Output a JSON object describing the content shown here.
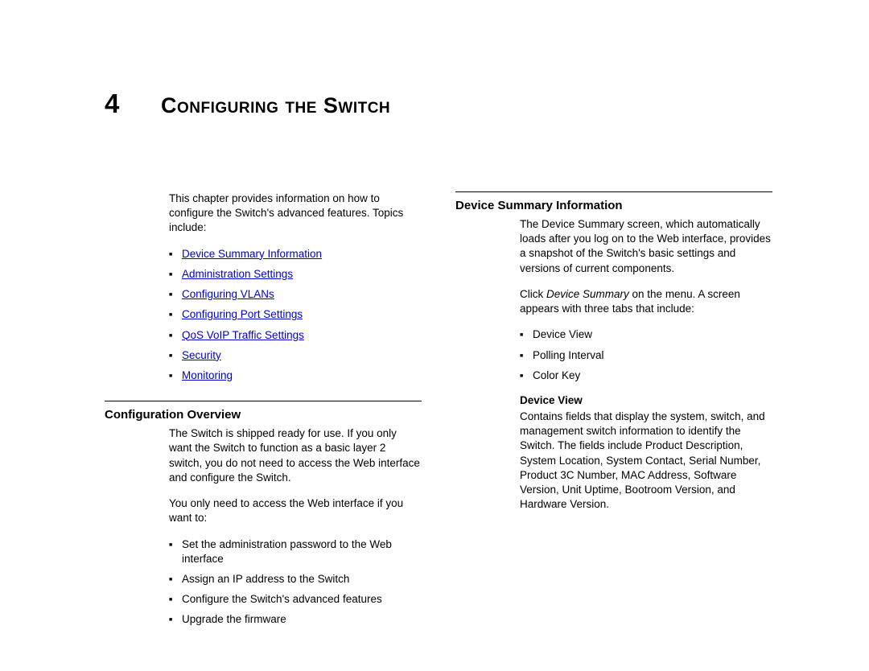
{
  "chapter": {
    "number": "4",
    "title": "Configuring the Switch"
  },
  "left": {
    "intro": "This chapter provides information on how to configure the Switch's advanced features. Topics include:",
    "links": [
      "Device Summary Information",
      "Administration Settings",
      "Configuring VLANs",
      "Configuring Port Settings",
      "QoS VoIP Traffic Settings",
      "Security",
      "Monitoring"
    ],
    "overview_heading": "Configuration Overview",
    "overview_p1": "The Switch is shipped ready for use. If you only want the Switch to function as a basic layer 2 switch, you do not need to access the Web interface and configure the Switch.",
    "overview_p2": "You only need to access the Web interface if you want to:",
    "overview_list": [
      "Set the administration password to the Web interface",
      "Assign an IP address to the Switch",
      "Configure the Switch's advanced features",
      "Upgrade the firmware"
    ]
  },
  "right": {
    "heading": "Device Summary Information",
    "p1": "The Device Summary screen, which automatically loads after you log on to the Web interface, provides a snapshot of the Switch's basic settings and versions of current components.",
    "p2_pre": "Click ",
    "p2_italic": "Device Summary",
    "p2_post": " on the menu. A screen appears with three tabs that include:",
    "tabs": [
      "Device View",
      "Polling Interval",
      "Color Key"
    ],
    "dv_heading": "Device View",
    "dv_body": "Contains fields that display the system, switch, and management switch information to identify the Switch. The fields include Product Description, System Location, System Contact, Serial Number, Product 3C Number, MAC Address, Software Version, Unit Uptime, Bootroom Version, and Hardware Version."
  }
}
